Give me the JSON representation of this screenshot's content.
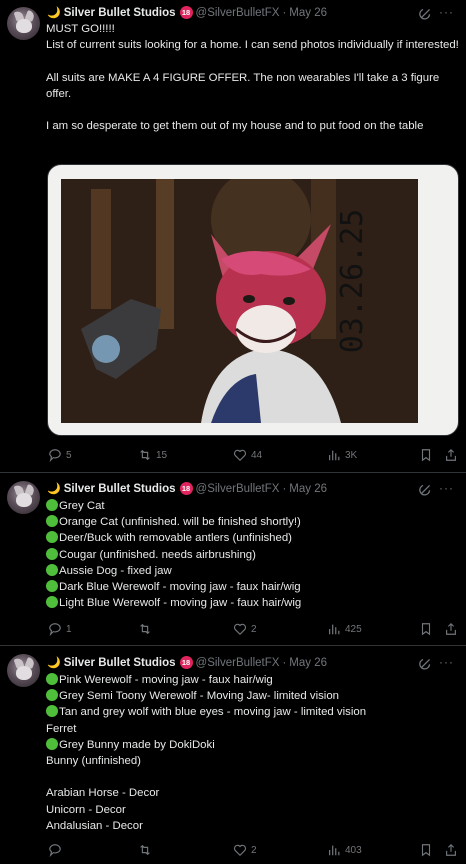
{
  "tweets": [
    {
      "author": {
        "name": "Silver Bullet Studios",
        "handle": "@SilverBulletFX",
        "badge": "18",
        "moon": "🌙"
      },
      "date": "May 26",
      "lines": [
        "MUST GO!!!!!",
        "List of current suits looking for a home. I can send photos individually if interested!",
        "",
        "All suits are MAKE A 4 FIGURE OFFER. The non wearables I'll take a 3 figure offer.",
        "",
        "I am so desperate to get them out of my house and to put food on the table"
      ],
      "photo": {
        "handwriting": "03.26.25"
      },
      "stats": {
        "replies": "5",
        "reposts": "15",
        "likes": "44",
        "views": "3K"
      }
    },
    {
      "author": {
        "name": "Silver Bullet Studios",
        "handle": "@SilverBulletFX",
        "badge": "18",
        "moon": "🌙"
      },
      "date": "May 26",
      "items": [
        {
          "dot": true,
          "text": "Grey Cat"
        },
        {
          "dot": true,
          "text": "Orange Cat (unfinished. will be finished shortly!)"
        },
        {
          "dot": true,
          "text": "Deer/Buck with removable antlers (unfinished)"
        },
        {
          "dot": true,
          "text": "Cougar (unfinished. needs airbrushing)"
        },
        {
          "dot": true,
          "text": "Aussie Dog - fixed jaw"
        },
        {
          "dot": true,
          "text": "Dark Blue Werewolf - moving jaw - faux hair/wig"
        },
        {
          "dot": true,
          "text": "Light Blue Werewolf - moving jaw - faux hair/wig"
        }
      ],
      "stats": {
        "replies": "1",
        "reposts": "",
        "likes": "2",
        "views": "425"
      }
    },
    {
      "author": {
        "name": "Silver Bullet Studios",
        "handle": "@SilverBulletFX",
        "badge": "18",
        "moon": "🌙"
      },
      "date": "May 26",
      "items": [
        {
          "dot": true,
          "text": "Pink Werewolf - moving jaw - faux hair/wig"
        },
        {
          "dot": true,
          "text": "Grey Semi Toony Werewolf - Moving Jaw- limited vision"
        },
        {
          "dot": true,
          "text": "Tan and grey wolf with blue eyes - moving jaw - limited vision"
        },
        {
          "dot": false,
          "text": "Ferret"
        },
        {
          "dot": true,
          "text": "Grey Bunny made by DokiDoki"
        },
        {
          "dot": false,
          "text": "Bunny (unfinished)"
        },
        {
          "dot": false,
          "text": ""
        },
        {
          "dot": false,
          "text": "Arabian Horse - Decor"
        },
        {
          "dot": false,
          "text": "Unicorn - Decor"
        },
        {
          "dot": false,
          "text": "Andalusian - Decor"
        }
      ],
      "stats": {
        "replies": "",
        "reposts": "",
        "likes": "2",
        "views": "403"
      }
    }
  ],
  "colors": {
    "background": "#000000",
    "text": "#e7e9ea",
    "muted": "#71767b",
    "divider": "#2f3336",
    "badge": "#e0245e",
    "green_dot": "#4fbf3b"
  },
  "icons": [
    "reply-icon",
    "repost-icon",
    "like-icon",
    "views-icon",
    "bookmark-icon",
    "share-icon",
    "grok-icon",
    "more-icon"
  ]
}
